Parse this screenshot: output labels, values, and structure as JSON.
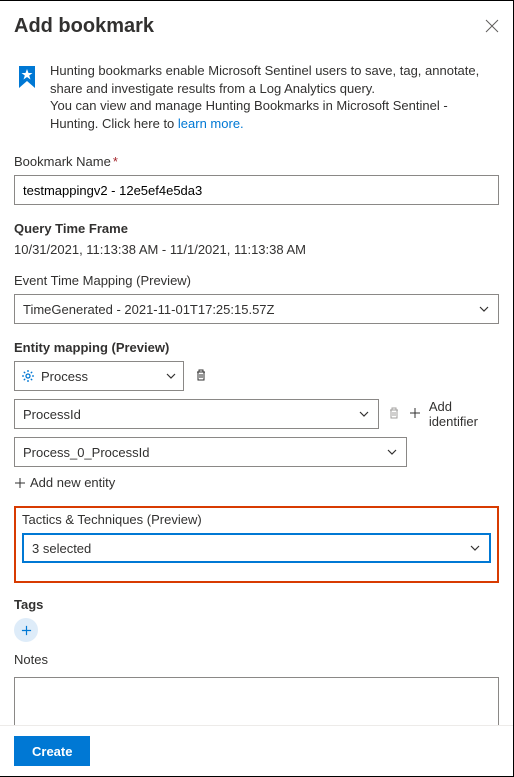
{
  "header": {
    "title": "Add bookmark"
  },
  "info": {
    "line1": "Hunting bookmarks enable Microsoft Sentinel users to save, tag, annotate, share and investigate results from a Log Analytics query.",
    "line2": "You can view and manage Hunting Bookmarks in Microsoft Sentinel - Hunting. Click here to",
    "link": "learn more."
  },
  "bookmarkName": {
    "label": "Bookmark Name",
    "value": "testmappingv2 - 12e5ef4e5da3"
  },
  "queryTimeFrame": {
    "label": "Query Time Frame",
    "value": "10/31/2021, 11:13:38 AM - 11/1/2021, 11:13:38 AM"
  },
  "eventTimeMapping": {
    "label": "Event Time Mapping (Preview)",
    "value": "TimeGenerated - 2021-11-01T17:25:15.57Z"
  },
  "entityMapping": {
    "label": "Entity mapping (Preview)",
    "entityType": "Process",
    "identifier": "ProcessId",
    "valueField": "Process_0_ProcessId",
    "addIdentifier": "Add identifier",
    "addNewEntity": "Add new entity"
  },
  "tactics": {
    "label": "Tactics & Techniques (Preview)",
    "value": "3 selected"
  },
  "tags": {
    "label": "Tags"
  },
  "notes": {
    "label": "Notes"
  },
  "footer": {
    "create": "Create"
  }
}
